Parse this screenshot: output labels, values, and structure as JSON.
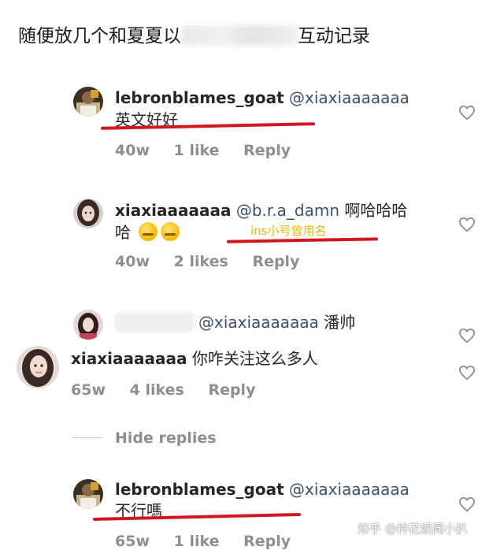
{
  "title": {
    "prefix": "随便放几个和夏夏以",
    "suffix": "互动记录"
  },
  "comments": [
    {
      "username": "lebronblames_goat",
      "mention": "@xiaxiaaaaaaa",
      "text": "英文好好",
      "time": "40w",
      "likes": "1 like",
      "reply": "Reply"
    },
    {
      "username": "xiaxiaaaaaaa",
      "mention": "@b.r.a_damn",
      "text": "啊哈哈哈",
      "text2": "哈",
      "annotation": "ins小号曾用名",
      "time": "40w",
      "likes": "2 likes",
      "reply": "Reply"
    },
    {
      "username": "",
      "mention": "@xiaxiaaaaaaa",
      "text": "潘帅"
    },
    {
      "username": "xiaxiaaaaaaa",
      "mention": "",
      "text": "你咋关注这么多人",
      "time": "65w",
      "likes": "4 likes",
      "reply": "Reply"
    },
    {
      "username": "lebronblames_goat",
      "mention": "@xiaxiaaaaaaa",
      "text": "不行嗎",
      "time": "65w",
      "likes": "1 like",
      "reply": "Reply"
    }
  ],
  "hide_replies": "Hide replies",
  "watermark": "知乎 @种花娱闻小扒",
  "colors": {
    "underline": "#d2181f",
    "annotation": "#e6b800",
    "meta": "#8e8e8e"
  }
}
